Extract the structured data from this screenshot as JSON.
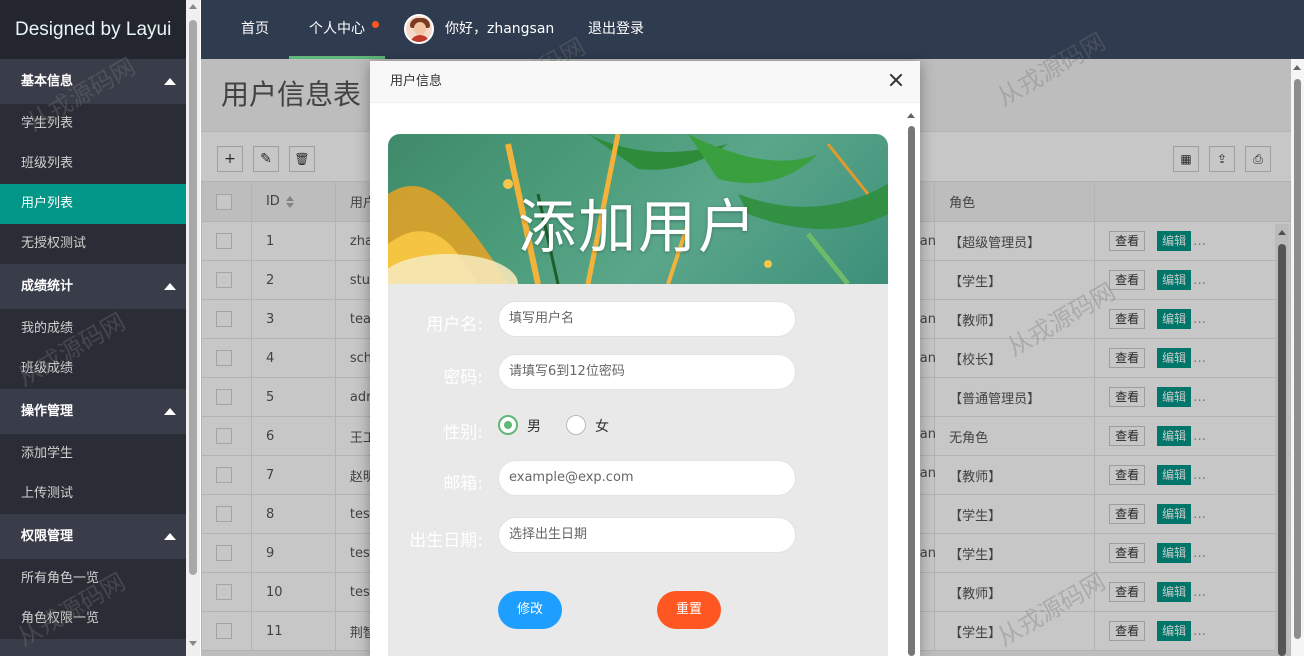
{
  "sidebar": {
    "logo": "Designed by Layui",
    "groups": [
      {
        "title": "基本信息",
        "items": [
          "学生列表",
          "班级列表",
          "用户列表",
          "无授权测试"
        ]
      },
      {
        "title": "成绩统计",
        "items": [
          "我的成绩",
          "班级成绩"
        ]
      },
      {
        "title": "操作管理",
        "items": [
          "添加学生",
          "上传测试"
        ]
      },
      {
        "title": "权限管理",
        "items": [
          "所有角色一览",
          "角色权限一览"
        ]
      }
    ]
  },
  "header": {
    "home": "首页",
    "personal": "个人中心",
    "greeting": "你好，zhangsan",
    "logout": "退出登录"
  },
  "main": {
    "title": "用户信息表",
    "columns": [
      "ID",
      "用户",
      "角色"
    ],
    "rows": [
      {
        "id": "1",
        "name": "zha",
        "tail": "nan",
        "role": "【超级管理员】"
      },
      {
        "id": "2",
        "name": "stu",
        "tail": "",
        "role": "【学生】"
      },
      {
        "id": "3",
        "name": "tea",
        "tail": "nan",
        "role": "【教师】"
      },
      {
        "id": "4",
        "name": "sch",
        "tail": "nan",
        "role": "【校长】"
      },
      {
        "id": "5",
        "name": "adr",
        "tail": "",
        "role": "【普通管理员】"
      },
      {
        "id": "6",
        "name": "王工",
        "tail": "nan",
        "role": "无角色"
      },
      {
        "id": "7",
        "name": "赵明",
        "tail": "nan",
        "role": "【教师】"
      },
      {
        "id": "8",
        "name": "tes",
        "tail": "",
        "role": "【学生】"
      },
      {
        "id": "9",
        "name": "tes",
        "tail": "nan",
        "role": "【学生】"
      },
      {
        "id": "10",
        "name": "tes",
        "tail": "",
        "role": "【教师】"
      },
      {
        "id": "11",
        "name": "荆智",
        "tail": "",
        "role": "【学生】"
      }
    ],
    "view_label": "查看",
    "edit_label": "编辑",
    "more": "…"
  },
  "modal": {
    "title": "用户信息",
    "banner_title": "添加用户",
    "fields": {
      "username_label": "用户名:",
      "username_placeholder": "填写用户名",
      "password_label": "密码:",
      "password_placeholder": "请填写6到12位密码",
      "gender_label": "性别:",
      "male": "男",
      "female": "女",
      "email_label": "邮箱:",
      "email_placeholder": "example@exp.com",
      "birth_label": "出生日期:",
      "birth_placeholder": "选择出生日期"
    },
    "submit_label": "修改",
    "reset_label": "重置",
    "gender_selected": "男"
  },
  "watermark": "从戎源码网",
  "colors": {
    "accent": "#009688",
    "header": "#2f3b4f",
    "sidebar": "#393d49",
    "submit": "#1e9fff",
    "reset": "#ff5722",
    "radio_on": "#5fb878"
  }
}
